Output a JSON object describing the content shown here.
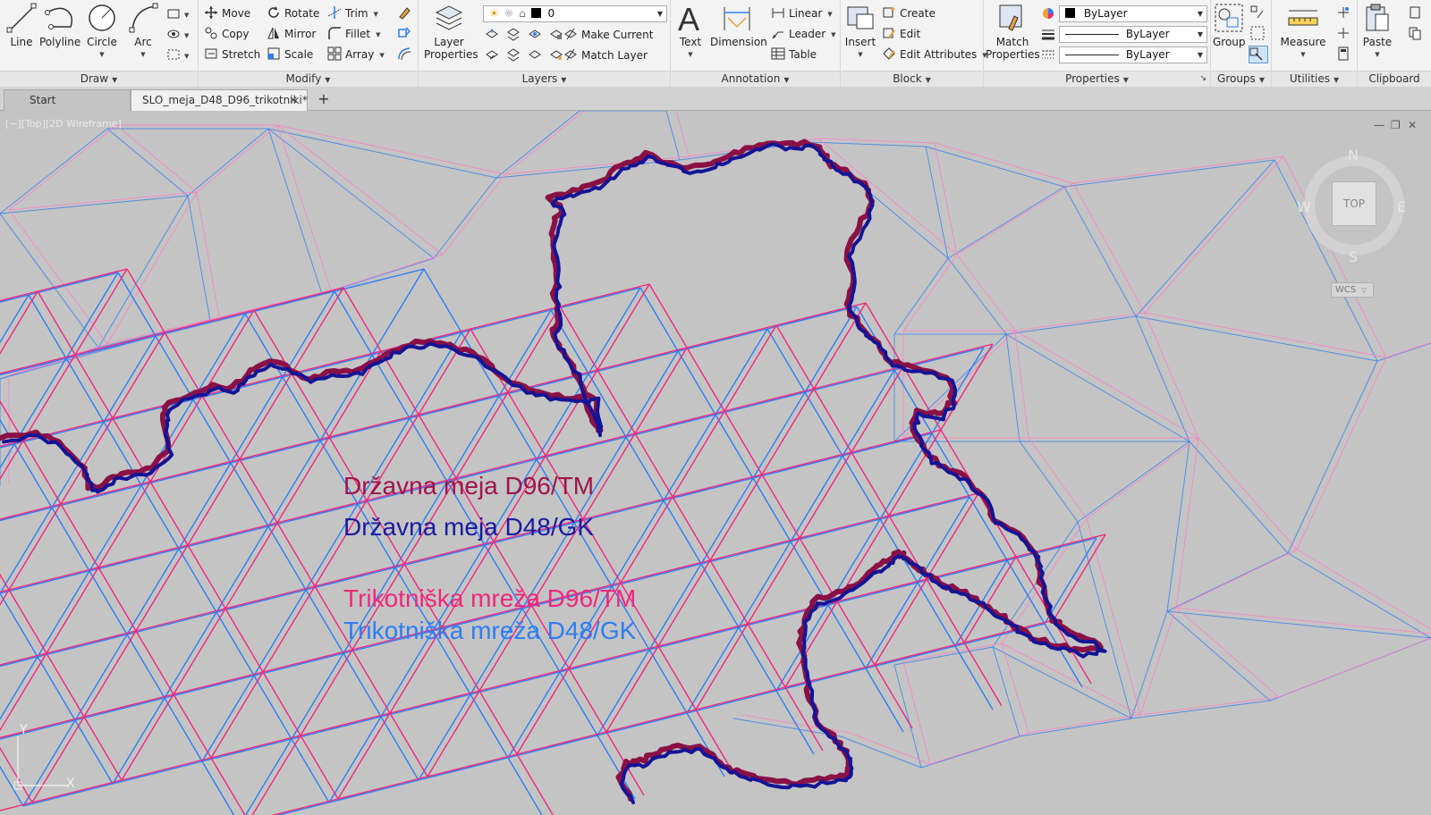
{
  "ribbon": {
    "draw": {
      "footer": "Draw",
      "line": "Line",
      "polyline": "Polyline",
      "circle": "Circle",
      "arc": "Arc"
    },
    "modify": {
      "footer": "Modify",
      "move": "Move",
      "rotate": "Rotate",
      "trim": "Trim",
      "copy": "Copy",
      "mirror": "Mirror",
      "fillet": "Fillet",
      "stretch": "Stretch",
      "scale": "Scale",
      "array": "Array"
    },
    "layers": {
      "footer": "Layers",
      "layer_properties_1": "Layer",
      "layer_properties_2": "Properties",
      "current_layer": "0",
      "make_current": "Make Current",
      "match_layer": "Match Layer"
    },
    "annotation": {
      "footer": "Annotation",
      "text": "Text",
      "dimension": "Dimension",
      "linear": "Linear",
      "leader": "Leader",
      "table": "Table"
    },
    "block": {
      "footer": "Block",
      "insert": "Insert",
      "create": "Create",
      "edit": "Edit",
      "edit_attributes": "Edit Attributes"
    },
    "properties": {
      "footer": "Properties",
      "match_properties_1": "Match",
      "match_properties_2": "Properties",
      "color": "ByLayer",
      "linetype": "ByLayer",
      "lineweight": "ByLayer"
    },
    "groups": {
      "footer": "Groups",
      "group": "Group"
    },
    "utilities": {
      "footer": "Utilities",
      "measure": "Measure"
    },
    "clipboard": {
      "footer": "Clipboard",
      "paste": "Paste"
    }
  },
  "tabs": [
    {
      "label": "Start"
    },
    {
      "label": "SLO_meja_D48_D96_trikotniki*"
    }
  ],
  "viewport": {
    "view_label": "[−][Top][2D Wireframe]",
    "viewcube": {
      "top": "TOP",
      "n": "N",
      "s": "S",
      "e": "E",
      "w": "W",
      "wcs": "WCS"
    },
    "ucs": {
      "x": "X",
      "y": "Y"
    }
  },
  "legend": [
    {
      "text": "Državna meja D96/TM",
      "color": "#a0144a"
    },
    {
      "text": "Državna meja D48/GK",
      "color": "#1a1aa0"
    },
    {
      "text": "Trikotniška mreža D96/TM",
      "color": "#f0287d"
    },
    {
      "text": "Trikotniška mreža D48/GK",
      "color": "#2d7ef5"
    }
  ],
  "colors": {
    "boundary_d96": "#8a1046",
    "boundary_d48": "#141496",
    "mesh_d96": "#f0287d",
    "mesh_d48": "#2d7ef5"
  }
}
